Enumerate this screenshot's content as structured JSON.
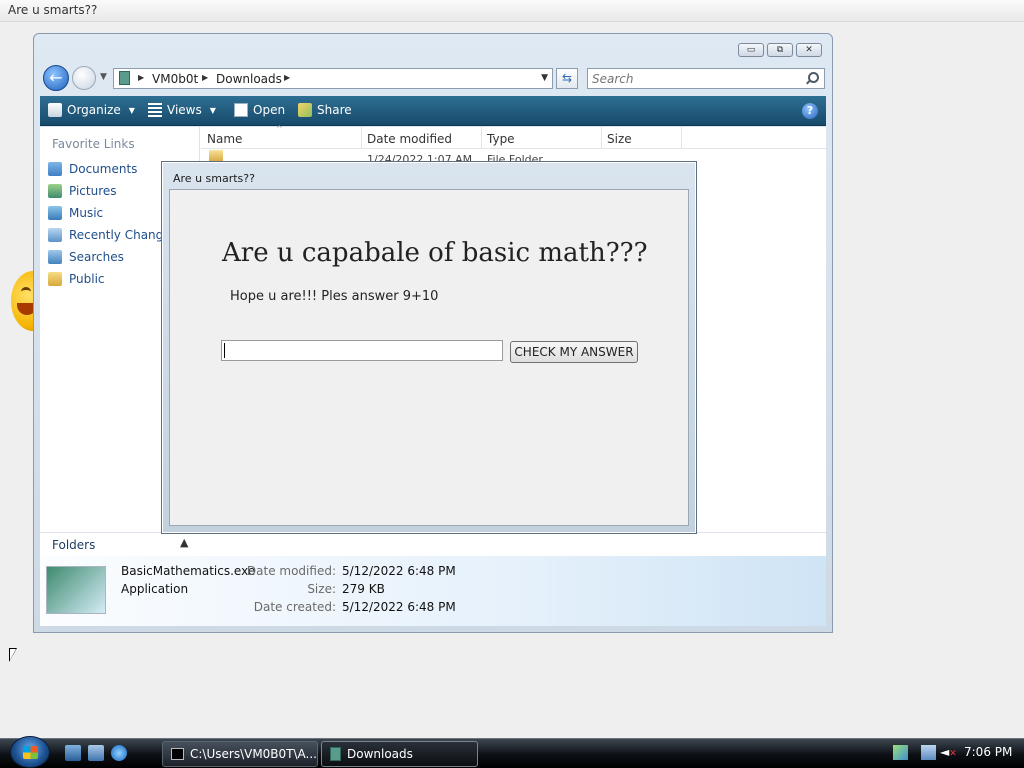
{
  "background_window": {
    "title": "Are u smarts??"
  },
  "explorer": {
    "controls": {
      "minimize": "▭",
      "restore": "⧉",
      "close": "✕"
    },
    "address": {
      "crumbs": [
        "VM0b0t",
        "Downloads"
      ]
    },
    "search": {
      "placeholder": "Search"
    },
    "toolbar": {
      "organize": "Organize",
      "views": "Views",
      "open": "Open",
      "share": "Share"
    },
    "sidebar": {
      "header": "Favorite Links",
      "items": [
        "Documents",
        "Pictures",
        "Music",
        "Recently Changed",
        "Searches",
        "Public"
      ]
    },
    "columns": {
      "name": "Name",
      "date_modified": "Date modified",
      "type": "Type",
      "size": "Size"
    },
    "partial_row": {
      "date": "1/24/2022 1:07 AM",
      "type": "File Folder"
    },
    "folders_label": "Folders",
    "details": {
      "filename": "BasicMathematics.exe",
      "filetype": "Application",
      "date_modified_label": "Date modified:",
      "date_modified": "5/12/2022 6:48 PM",
      "size_label": "Size:",
      "size": "279 KB",
      "date_created_label": "Date created:",
      "date_created": "5/12/2022 6:48 PM"
    }
  },
  "dialog": {
    "title": "Are u smarts??",
    "heading": "Are u capabale of basic math???",
    "subtext": "Hope u are!!! Ples answer 9+10",
    "answer_value": "",
    "button_label": "CHECK MY ANSWER"
  },
  "taskbar": {
    "tasks": [
      {
        "label": "C:\\Users\\VM0B0T\\A...",
        "icon": "cmd-icon"
      },
      {
        "label": "Downloads",
        "icon": "folder-icon"
      }
    ],
    "clock": "7:06 PM"
  }
}
